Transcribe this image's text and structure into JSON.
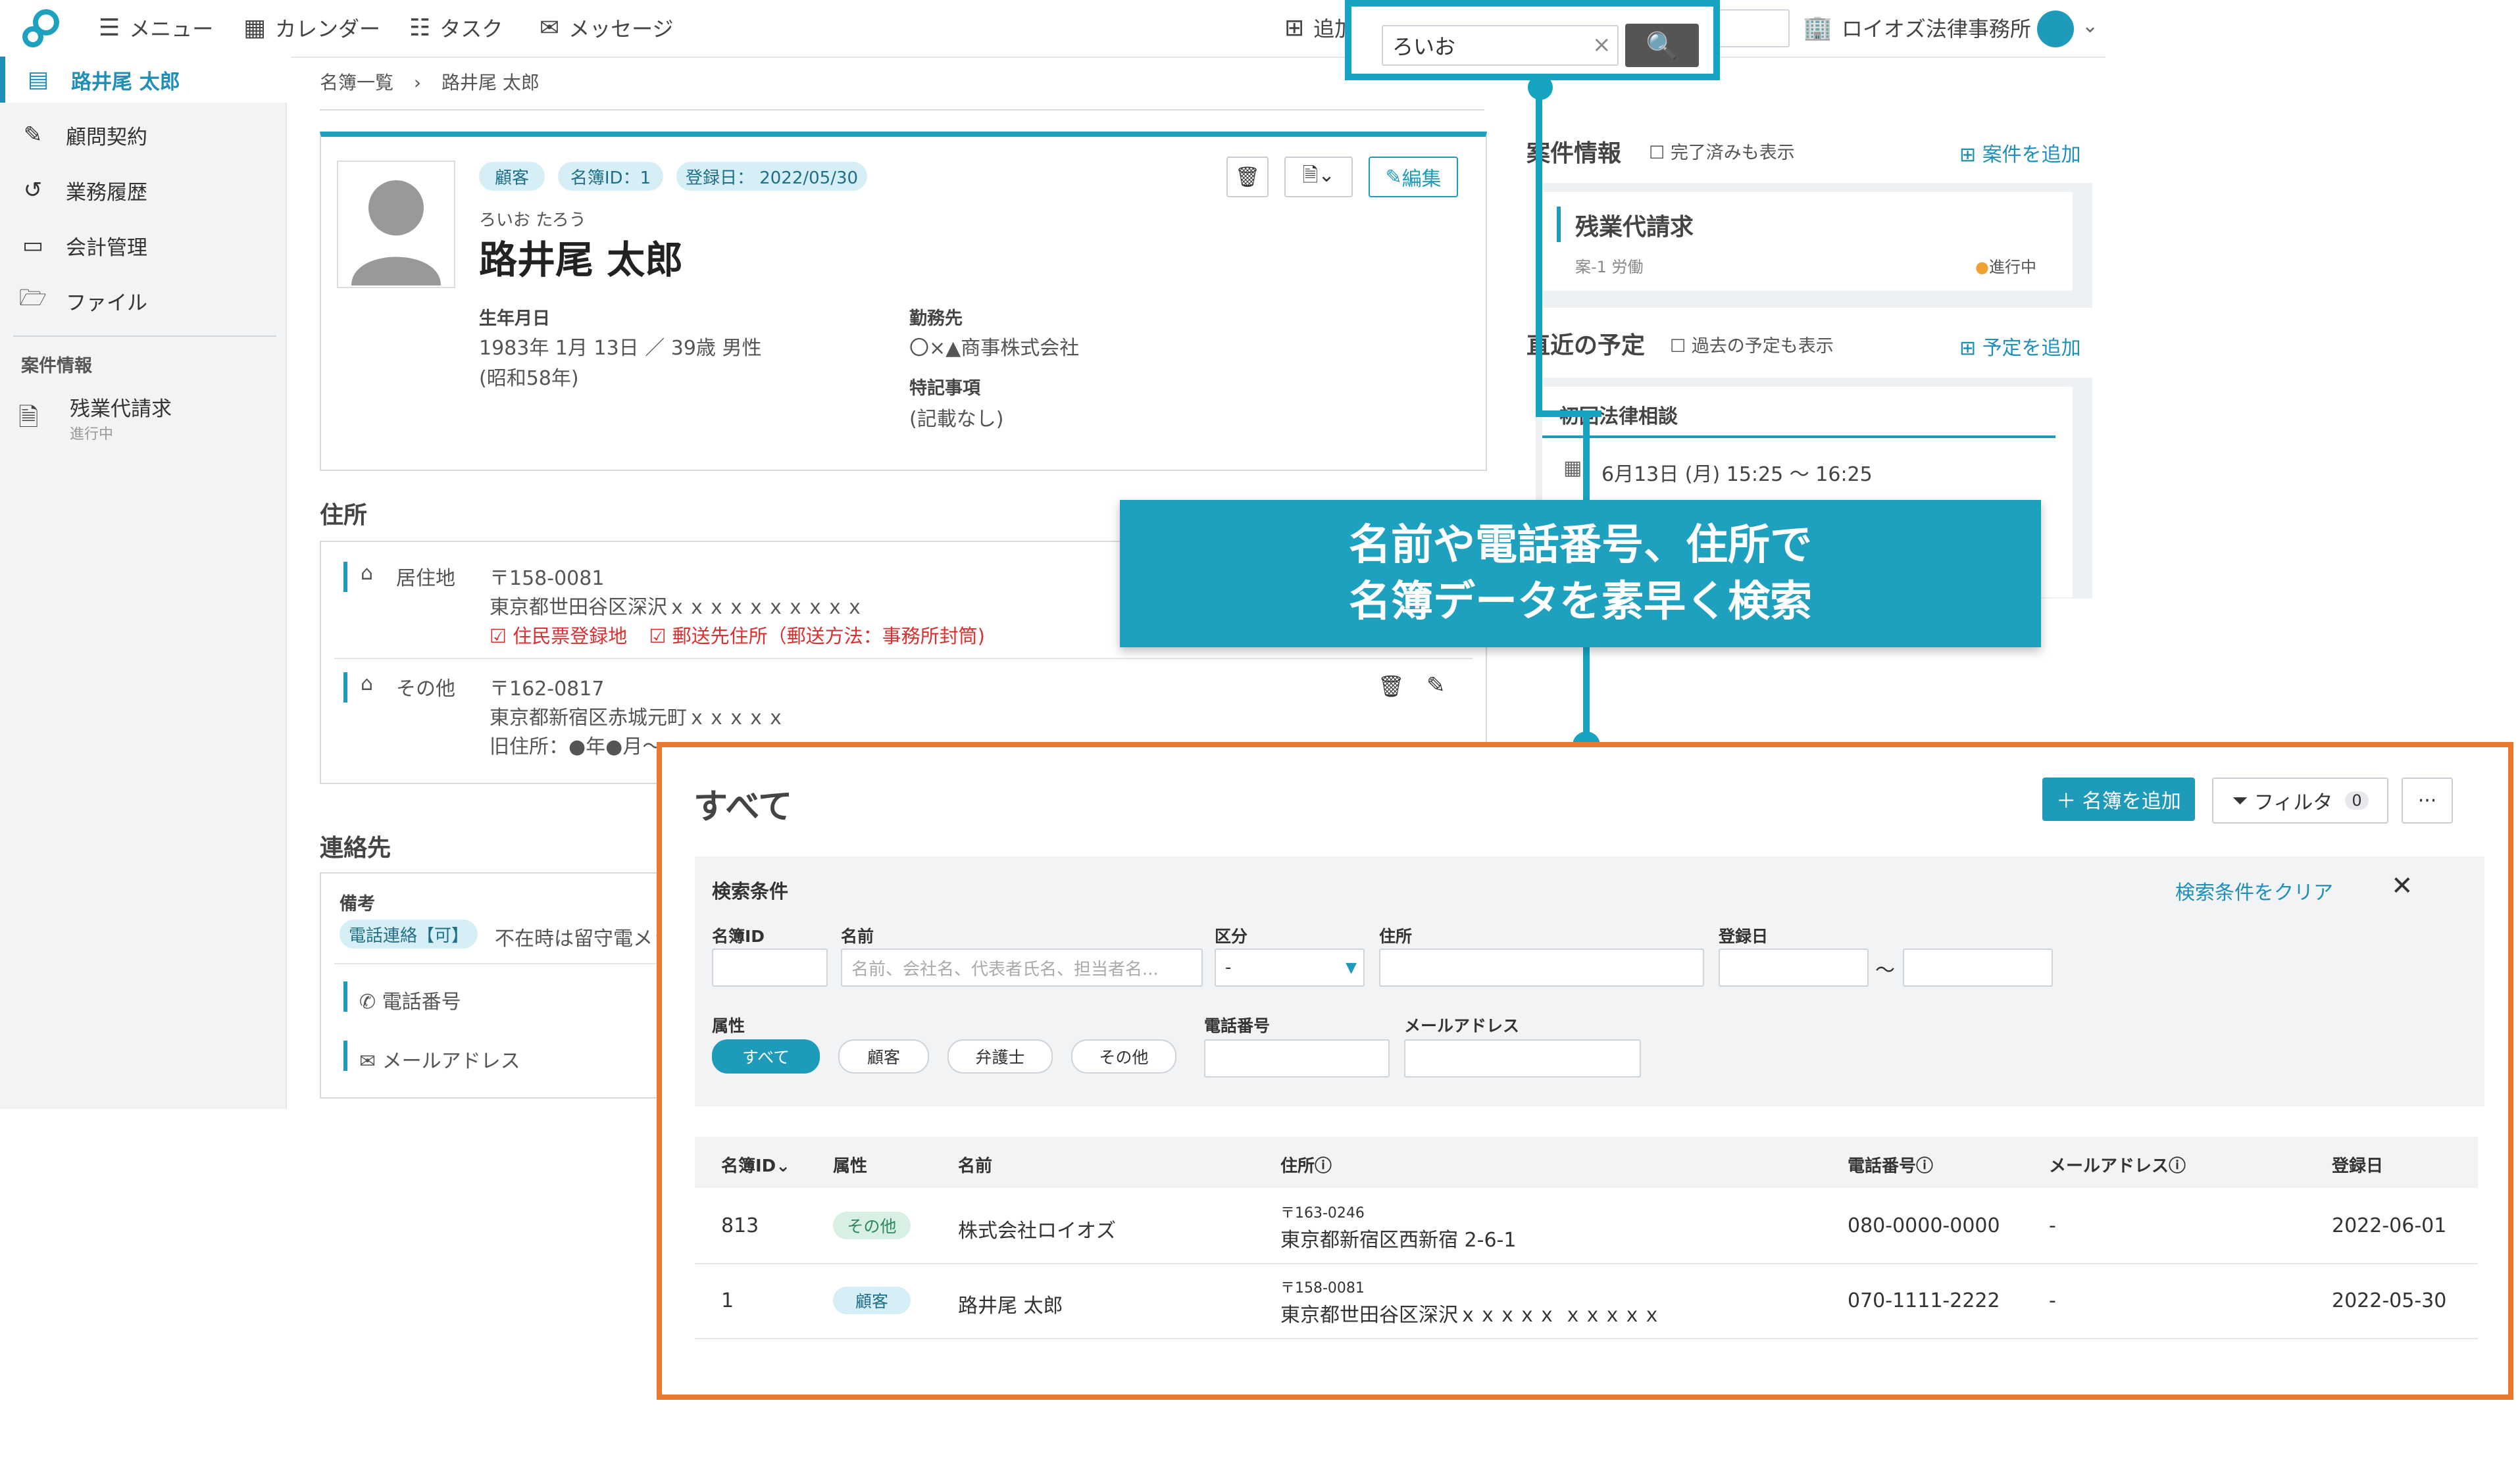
{
  "topbar": {
    "menu": "メニュー",
    "calendar": "カレンダー",
    "tasks": "タスク",
    "messages": "メッセージ",
    "add": "追加",
    "office": "ロイオズ法律事務所",
    "search_value": "ろいお"
  },
  "sidebar": {
    "items": [
      {
        "label": "路井尾 太郎",
        "icon": "id-card-icon"
      },
      {
        "label": "顧問契約",
        "icon": "contract-icon"
      },
      {
        "label": "業務履歴",
        "icon": "history-icon"
      },
      {
        "label": "会計管理",
        "icon": "wallet-icon"
      },
      {
        "label": "ファイル",
        "icon": "folder-icon"
      }
    ],
    "case_section": "案件情報",
    "case_name": "残業代請求",
    "case_status": "進行中"
  },
  "breadcrumb": {
    "parent": "名簿一覧",
    "current": "路井尾 太郎"
  },
  "profile": {
    "tags": [
      "顧客",
      "名簿ID：1",
      "登録日： 2022/05/30"
    ],
    "edit": "編集",
    "furigana": "ろいお たろう",
    "name": "路井尾 太郎",
    "birth_label": "生年月日",
    "birth_value": "1983年 1月 13日 ／ 39歳 男性",
    "birth_era": "(昭和58年)",
    "work_label": "勤務先",
    "work_value": "〇×▲商事株式会社",
    "notes_label": "特記事項",
    "notes_value": "(記載なし)"
  },
  "address": {
    "title": "住所",
    "items": [
      {
        "type": "居住地",
        "zip": "〒158-0081",
        "line": "東京都世田谷区深沢ｘｘｘｘｘｘｘｘｘｘ",
        "flag1": "住民票登録地",
        "flag2": "郵送先住所（郵送方法：事務所封筒)"
      },
      {
        "type": "その他",
        "zip": "〒162-0817",
        "line": "東京都新宿区赤城元町ｘｘｘｘｘ",
        "old": "旧住所：●年●月〜"
      }
    ]
  },
  "contact": {
    "title": "連絡先",
    "memo_label": "備考",
    "memo_tag": "電話連絡【可】",
    "memo_text": "不在時は留守電メッ",
    "phone": "電話番号",
    "mail": "メールアドレス"
  },
  "right_panel": {
    "case_title": "案件情報",
    "case_done": "完了済みも表示",
    "case_add": "案件を追加",
    "case_name": "残業代請求",
    "case_sub": "案-1 労働",
    "case_status": "進行中",
    "sched_title": "直近の予定",
    "sched_past": "過去の予定も表示",
    "sched_add": "予定を追加",
    "sched_name": "初回法律相談",
    "sched_time": "6月13日 (月) 15:25 〜 16:25"
  },
  "callout": {
    "line1": "名前や電話番号、住所で",
    "line2": "名簿データを素早く検索"
  },
  "search_panel": {
    "title": "すべて",
    "add_button": "名簿を追加",
    "filter_button": "フィルタ",
    "filter_count": "0",
    "more": "···",
    "cond_title": "検索条件",
    "clear": "検索条件をクリア",
    "labels": {
      "id": "名簿ID",
      "name": "名前",
      "kubun": "区分",
      "address": "住所",
      "date": "登録日",
      "attr": "属性",
      "phone": "電話番号",
      "mail": "メールアドレス"
    },
    "name_placeholder": "名前、会社名、代表者氏名、担当者名...",
    "kubun_value": "-",
    "tilde": "〜",
    "attr_options": [
      "すべて",
      "顧客",
      "弁護士",
      "その他"
    ],
    "columns": [
      "名簿ID",
      "属性",
      "名前",
      "住所",
      "電話番号",
      "メールアドレス",
      "登録日"
    ],
    "rows": [
      {
        "id": "813",
        "attr": "その他",
        "name": "株式会社ロイオズ",
        "zip": "〒163-0246",
        "addr": "東京都新宿区西新宿 2-6-1",
        "phone": "080-0000-0000",
        "mail": "-",
        "date": "2022-06-01"
      },
      {
        "id": "1",
        "attr": "顧客",
        "name": "路井尾 太郎",
        "zip": "〒158-0081",
        "addr": "東京都世田谷区深沢ｘｘｘｘｘ ｘｘｘｘｘ",
        "phone": "070-1111-2222",
        "mail": "-",
        "date": "2022-05-30"
      }
    ]
  }
}
